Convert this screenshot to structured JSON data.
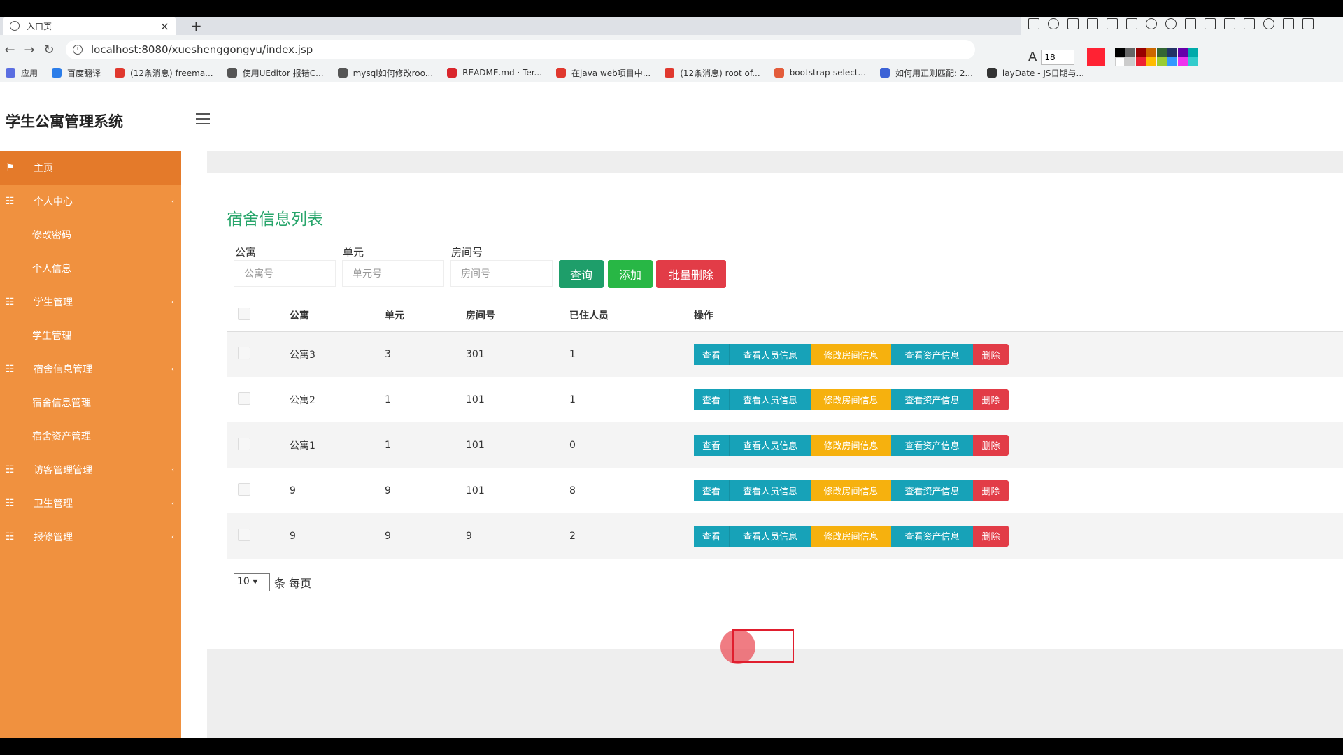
{
  "browser": {
    "tab_title": "入口页",
    "url": "localhost:8080/xueshenggongyu/index.jsp",
    "font_size": "18",
    "bookmarks": [
      {
        "label": "应用",
        "color": "#5b6ee1"
      },
      {
        "label": "百度翻译",
        "color": "#2b7de9"
      },
      {
        "label": "(12条消息) freema...",
        "color": "#e0382e"
      },
      {
        "label": "使用UEditor 报错C...",
        "color": "#555"
      },
      {
        "label": "mysql如何修改roo...",
        "color": "#555"
      },
      {
        "label": "README.md · Ter...",
        "color": "#d9262c"
      },
      {
        "label": "在java web项目中...",
        "color": "#e0382e"
      },
      {
        "label": "(12条消息) root of...",
        "color": "#e0382e"
      },
      {
        "label": "bootstrap-select...",
        "color": "#e35c3b"
      },
      {
        "label": "如何用正则匹配: 2...",
        "color": "#3c62d6"
      },
      {
        "label": "layDate - JS日期与...",
        "color": "#333"
      }
    ]
  },
  "app": {
    "brand": "学生公寓管理系统",
    "sidebar": [
      {
        "label": "主页",
        "type": "top",
        "icon": "flag-icon"
      },
      {
        "label": "个人中心",
        "type": "group",
        "icon": "grid-icon"
      },
      {
        "label": "修改密码",
        "type": "sub"
      },
      {
        "label": "个人信息",
        "type": "sub"
      },
      {
        "label": "学生管理",
        "type": "group",
        "icon": "grid-icon"
      },
      {
        "label": "学生管理",
        "type": "sub"
      },
      {
        "label": "宿舍信息管理",
        "type": "group",
        "icon": "grid-icon"
      },
      {
        "label": "宿舍信息管理",
        "type": "sub"
      },
      {
        "label": "宿舍资产管理",
        "type": "sub"
      },
      {
        "label": "访客管理管理",
        "type": "group",
        "icon": "grid-icon"
      },
      {
        "label": "卫生管理",
        "type": "group",
        "icon": "grid-icon"
      },
      {
        "label": "报修管理",
        "type": "group",
        "icon": "grid-icon"
      }
    ],
    "panel_title": "宿舍信息列表",
    "filters": {
      "apartment_label": "公寓",
      "apartment_placeholder": "公寓号",
      "unit_label": "单元",
      "unit_placeholder": "单元号",
      "room_label": "房间号",
      "room_placeholder": "房间号",
      "query_btn": "查询",
      "add_btn": "添加",
      "batch_delete_btn": "批量删除"
    },
    "table": {
      "headers": [
        "公寓",
        "单元",
        "房间号",
        "已住人员",
        "操作"
      ],
      "actions": [
        "查看",
        "查看人员信息",
        "修改房间信息",
        "查看资产信息",
        "删除"
      ],
      "rows": [
        {
          "apartment": "公寓3",
          "unit": "3",
          "room": "301",
          "occupants": "1"
        },
        {
          "apartment": "公寓2",
          "unit": "1",
          "room": "101",
          "occupants": "1"
        },
        {
          "apartment": "公寓1",
          "unit": "1",
          "room": "101",
          "occupants": "0"
        },
        {
          "apartment": "9",
          "unit": "9",
          "room": "101",
          "occupants": "8"
        },
        {
          "apartment": "9",
          "unit": "9",
          "room": "9",
          "occupants": "2"
        }
      ]
    },
    "pagesize": {
      "value": "10",
      "suffix": "条 每页"
    },
    "colors": {
      "sidebar": "#f0913f",
      "title": "#28a56b",
      "query": "#1e9e6a",
      "add": "#28b745",
      "delete": "#e23c47",
      "info": "#17a2b8",
      "warning": "#f6b10e"
    }
  }
}
